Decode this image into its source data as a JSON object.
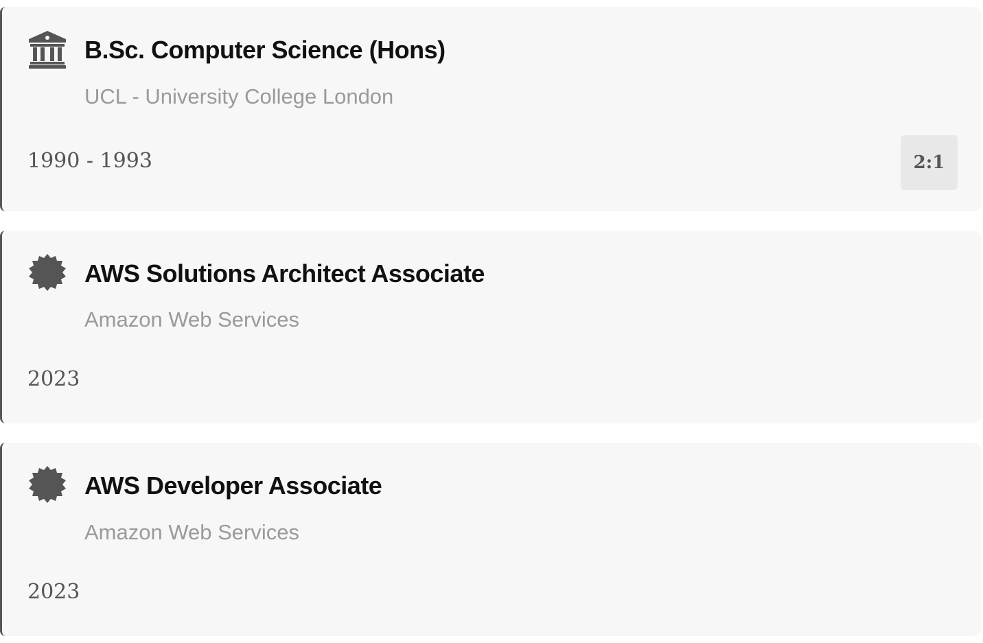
{
  "entries": [
    {
      "icon": "university-icon",
      "title": "B.Sc. Computer Science (Hons)",
      "organization": "UCL - University College London",
      "dates": "1990 - 1993",
      "grade": "2:1"
    },
    {
      "icon": "certificate-badge-icon",
      "title": "AWS Solutions Architect Associate",
      "organization": "Amazon Web Services",
      "dates": "2023"
    },
    {
      "icon": "certificate-badge-icon",
      "title": "AWS Developer Associate",
      "organization": "Amazon Web Services",
      "dates": "2023"
    }
  ],
  "colors": {
    "card_background": "#f7f7f7",
    "card_border": "#555555",
    "icon": "#555555",
    "title": "#111111",
    "subtitle": "#9a9a9a",
    "grade_background": "#e8e8e8"
  }
}
